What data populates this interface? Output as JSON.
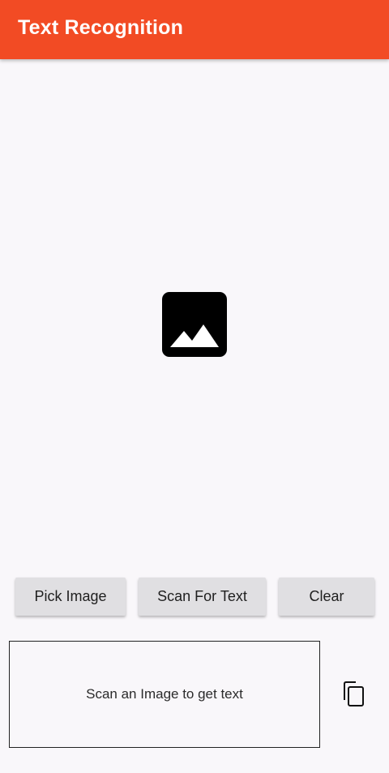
{
  "app_bar": {
    "title": "Text Recognition",
    "color": "#f24b24"
  },
  "image_area": {
    "icon": "image-placeholder-icon"
  },
  "buttons": {
    "pick_image": "Pick Image",
    "scan_for_text": "Scan For Text",
    "clear": "Clear"
  },
  "result": {
    "text": "Scan an Image to get text"
  },
  "copy": {
    "icon": "copy-icon"
  }
}
